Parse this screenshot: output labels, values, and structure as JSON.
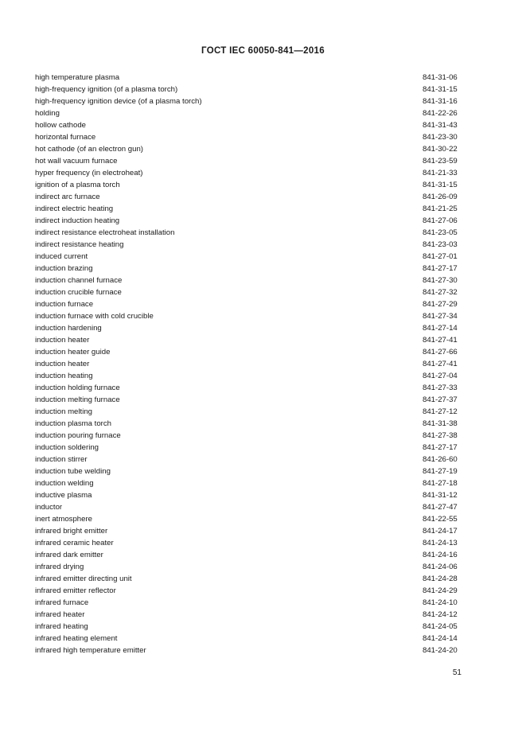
{
  "document": {
    "running_head": "ГОСТ IEC 60050-841—2016",
    "page_number": "51"
  },
  "index": {
    "entries": [
      {
        "term": "high temperature plasma",
        "code": "841-31-06"
      },
      {
        "term": "high-frequency ignition (of a plasma torch)",
        "code": "841-31-15"
      },
      {
        "term": "high-frequency ignition device (of a plasma torch)",
        "code": "841-31-16"
      },
      {
        "term": "holding",
        "code": "841-22-26"
      },
      {
        "term": "hollow cathode",
        "code": "841-31-43"
      },
      {
        "term": "horizontal furnace",
        "code": "841-23-30"
      },
      {
        "term": "hot cathode (of an electron gun)",
        "code": "841-30-22"
      },
      {
        "term": "hot wall vacuum furnace",
        "code": "841-23-59"
      },
      {
        "term": "hyper frequency (in electroheat)",
        "code": "841-21-33"
      },
      {
        "term": "ignition of a plasma torch",
        "code": "841-31-15"
      },
      {
        "term": "indirect arc furnace",
        "code": "841-26-09"
      },
      {
        "term": "indirect electric heating",
        "code": "841-21-25"
      },
      {
        "term": "indirect induction heating",
        "code": "841-27-06"
      },
      {
        "term": "indirect resistance electroheat installation",
        "code": "841-23-05"
      },
      {
        "term": "indirect resistance heating",
        "code": "841-23-03"
      },
      {
        "term": "induced current",
        "code": "841-27-01"
      },
      {
        "term": "induction brazing",
        "code": "841-27-17"
      },
      {
        "term": "induction channel furnace",
        "code": "841-27-30"
      },
      {
        "term": "induction crucible furnace",
        "code": "841-27-32"
      },
      {
        "term": "induction furnace",
        "code": "841-27-29"
      },
      {
        "term": "induction furnace with cold crucible",
        "code": "841-27-34"
      },
      {
        "term": "induction hardening",
        "code": "841-27-14"
      },
      {
        "term": "induction heater",
        "code": "841-27-41"
      },
      {
        "term": "induction heater guide",
        "code": "841-27-66"
      },
      {
        "term": "induction heater",
        "code": "841-27-41"
      },
      {
        "term": "induction heating",
        "code": "841-27-04"
      },
      {
        "term": "induction holding furnace",
        "code": "841-27-33"
      },
      {
        "term": "induction melting furnace",
        "code": "841-27-37"
      },
      {
        "term": "induction melting",
        "code": "841-27-12"
      },
      {
        "term": "induction plasma torch",
        "code": "841-31-38"
      },
      {
        "term": "induction pouring furnace",
        "code": "841-27-38"
      },
      {
        "term": "induction soldering",
        "code": "841-27-17"
      },
      {
        "term": "induction stirrer",
        "code": "841-26-60"
      },
      {
        "term": "induction tube welding",
        "code": "841-27-19"
      },
      {
        "term": "induction welding",
        "code": "841-27-18"
      },
      {
        "term": "inductive plasma",
        "code": "841-31-12"
      },
      {
        "term": "inductor",
        "code": "841-27-47"
      },
      {
        "term": "inert atmosphere",
        "code": "841-22-55"
      },
      {
        "term": "infrared bright emitter",
        "code": "841-24-17"
      },
      {
        "term": "infrared ceramic heater",
        "code": "841-24-13"
      },
      {
        "term": "infrared dark emitter",
        "code": "841-24-16"
      },
      {
        "term": "infrared drying",
        "code": "841-24-06"
      },
      {
        "term": "infrared emitter directing unit",
        "code": "841-24-28"
      },
      {
        "term": "infrared emitter reflector",
        "code": "841-24-29"
      },
      {
        "term": "infrared furnace",
        "code": "841-24-10"
      },
      {
        "term": "infrared heater",
        "code": "841-24-12"
      },
      {
        "term": "infrared heating",
        "code": "841-24-05"
      },
      {
        "term": "infrared heating element",
        "code": "841-24-14"
      },
      {
        "term": "infrared high temperature emitter",
        "code": "841-24-20"
      }
    ]
  }
}
